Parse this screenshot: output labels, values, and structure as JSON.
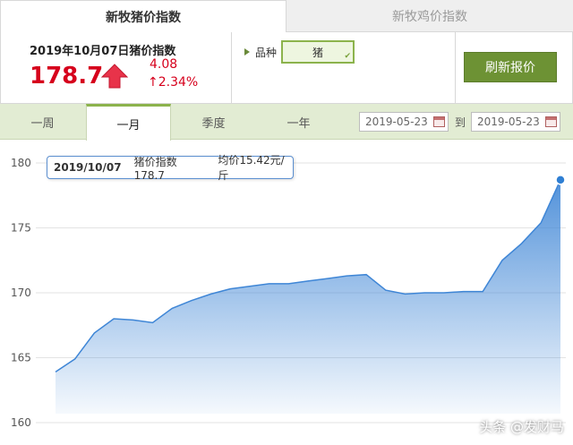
{
  "tabs": [
    {
      "label": "新牧猪价指数",
      "active": true
    },
    {
      "label": "新牧鸡价指数",
      "active": false
    }
  ],
  "price_panel": {
    "date_label": "2019年10月07日猪价指数",
    "index_value": "178.7",
    "trend_icon": "up-arrow-icon",
    "change_abs": "4.08",
    "change_pct": "↑2.34%"
  },
  "variety": {
    "label": "品种",
    "selected": "猪"
  },
  "refresh_button": "刷新报价",
  "period_tabs": [
    "一周",
    "一月",
    "季度",
    "一年"
  ],
  "active_period": "一月",
  "date_range": {
    "from": "2019-05-23",
    "to_label": "到",
    "to": "2019-05-23"
  },
  "tooltip": {
    "date": "2019/10/07",
    "index_text": "猪价指数178.7",
    "avg_text": "均价15.42元/斤"
  },
  "watermark": "头条 @发财马",
  "colors": {
    "accent_green": "#6d9234",
    "price_red": "#d6001c",
    "line_blue": "#3f86d6"
  },
  "chart_data": {
    "type": "area",
    "ylim": [
      160,
      180
    ],
    "yticks": [
      180,
      175,
      170,
      165,
      160
    ],
    "grid": true,
    "x": [
      1,
      2,
      3,
      4,
      5,
      6,
      7,
      8,
      9,
      10,
      11,
      12,
      13,
      14,
      15,
      16,
      17,
      18,
      19,
      20,
      21,
      22,
      23,
      24,
      25,
      26,
      27
    ],
    "values": [
      163.9,
      164.9,
      166.9,
      168.0,
      167.9,
      167.7,
      168.8,
      169.4,
      169.9,
      170.3,
      170.5,
      170.7,
      170.7,
      170.9,
      171.1,
      171.3,
      171.4,
      170.2,
      169.9,
      170.0,
      170.0,
      170.1,
      170.1,
      172.5,
      173.8,
      175.4,
      178.7
    ]
  }
}
